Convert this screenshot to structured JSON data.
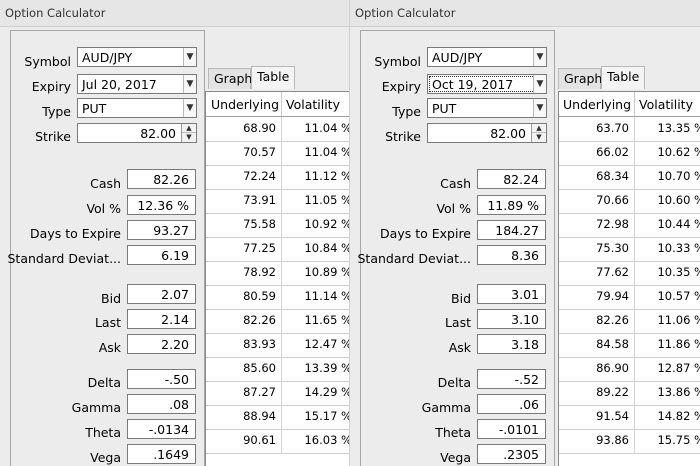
{
  "windows": [
    {
      "title": "Option Calculator",
      "symbol_label": "Symbol",
      "symbol": "AUD/JPY",
      "expiry_label": "Expiry",
      "expiry": "Jul 20, 2017",
      "type_label": "Type",
      "type": "PUT",
      "strike_label": "Strike",
      "strike": "82.00",
      "cash_label": "Cash",
      "cash": "82.26",
      "vol_label": "Vol %",
      "vol": "12.36 %",
      "days_label": "Days to Expire",
      "days": "93.27",
      "stddev_label": "Standard Deviat...",
      "stddev": "6.19",
      "bid_label": "Bid",
      "bid": "2.07",
      "last_label": "Last",
      "last": "2.14",
      "ask_label": "Ask",
      "ask": "2.20",
      "delta_label": "Delta",
      "delta": "-.50",
      "gamma_label": "Gamma",
      "gamma": ".08",
      "theta_label": "Theta",
      "theta": "-.0134",
      "vega_label": "Vega",
      "vega": ".1649",
      "tabs": [
        "Graph",
        "Table"
      ],
      "active_tab": "Table",
      "table": {
        "headers": [
          "Underlying",
          "Volatility"
        ],
        "rows": [
          [
            "68.90",
            "11.04 %"
          ],
          [
            "70.57",
            "11.04 %"
          ],
          [
            "72.24",
            "11.12 %"
          ],
          [
            "73.91",
            "11.05 %"
          ],
          [
            "75.58",
            "10.92 %"
          ],
          [
            "77.25",
            "10.84 %"
          ],
          [
            "78.92",
            "10.89 %"
          ],
          [
            "80.59",
            "11.14 %"
          ],
          [
            "82.26",
            "11.65 %"
          ],
          [
            "83.93",
            "12.47 %"
          ],
          [
            "85.60",
            "13.39 %"
          ],
          [
            "87.27",
            "14.29 %"
          ],
          [
            "88.94",
            "15.17 %"
          ],
          [
            "90.61",
            "16.03 %"
          ]
        ]
      }
    },
    {
      "title": "Option Calculator",
      "symbol_label": "Symbol",
      "symbol": "AUD/JPY",
      "expiry_label": "Expiry",
      "expiry": "Oct 19, 2017",
      "type_label": "Type",
      "type": "PUT",
      "strike_label": "Strike",
      "strike": "82.00",
      "cash_label": "Cash",
      "cash": "82.24",
      "vol_label": "Vol %",
      "vol": "11.89 %",
      "days_label": "Days to Expire",
      "days": "184.27",
      "stddev_label": "Standard Deviat...",
      "stddev": "8.36",
      "bid_label": "Bid",
      "bid": "3.01",
      "last_label": "Last",
      "last": "3.10",
      "ask_label": "Ask",
      "ask": "3.18",
      "delta_label": "Delta",
      "delta": "-.52",
      "gamma_label": "Gamma",
      "gamma": ".06",
      "theta_label": "Theta",
      "theta": "-.0101",
      "vega_label": "Vega",
      "vega": ".2305",
      "tabs": [
        "Graph",
        "Table"
      ],
      "active_tab": "Table",
      "table": {
        "headers": [
          "Underlying",
          "Volatility"
        ],
        "rows": [
          [
            "63.70",
            "13.35 %"
          ],
          [
            "66.02",
            "10.62 %"
          ],
          [
            "68.34",
            "10.70 %"
          ],
          [
            "70.66",
            "10.60 %"
          ],
          [
            "72.98",
            "10.44 %"
          ],
          [
            "75.30",
            "10.33 %"
          ],
          [
            "77.62",
            "10.35 %"
          ],
          [
            "79.94",
            "10.57 %"
          ],
          [
            "82.26",
            "11.06 %"
          ],
          [
            "84.58",
            "11.86 %"
          ],
          [
            "86.90",
            "12.87 %"
          ],
          [
            "89.22",
            "13.86 %"
          ],
          [
            "91.54",
            "14.82 %"
          ],
          [
            "93.86",
            "15.75 %"
          ]
        ]
      }
    }
  ]
}
